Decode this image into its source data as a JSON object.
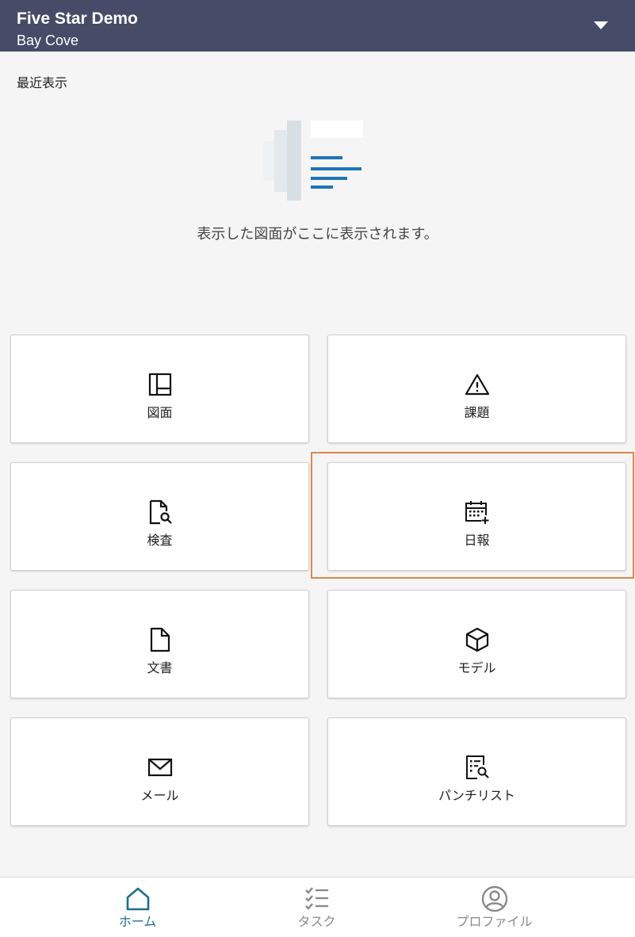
{
  "header": {
    "project_name": "Five Star Demo",
    "location": "Bay Cove",
    "background_color": "#464c67",
    "dropdown_icon": "caret-down-icon"
  },
  "recent": {
    "title": "最近表示",
    "empty_message": "表示した図面がここに表示されます。",
    "illustration_icon": "document-stack-illustration"
  },
  "tiles": [
    {
      "label": "図面",
      "icon": "sheet-layout-icon"
    },
    {
      "label": "課題",
      "icon": "warning-triangle-icon"
    },
    {
      "label": "検査",
      "icon": "document-search-icon"
    },
    {
      "label": "日報",
      "icon": "calendar-add-icon",
      "highlighted": true
    },
    {
      "label": "文書",
      "icon": "document-icon"
    },
    {
      "label": "モデル",
      "icon": "cube-icon"
    },
    {
      "label": "メール",
      "icon": "envelope-icon"
    },
    {
      "label": "パンチリスト",
      "icon": "checklist-search-icon"
    }
  ],
  "bottom_nav": {
    "items": [
      {
        "label": "ホーム",
        "icon": "home-icon",
        "active": true
      },
      {
        "label": "タスク",
        "icon": "checklist-icon",
        "active": false
      },
      {
        "label": "プロファイル",
        "icon": "user-circle-icon",
        "active": false
      }
    ],
    "active_color": "#1c6f8c",
    "inactive_color": "#8a8a8a"
  },
  "highlight_color": "#e0874a"
}
